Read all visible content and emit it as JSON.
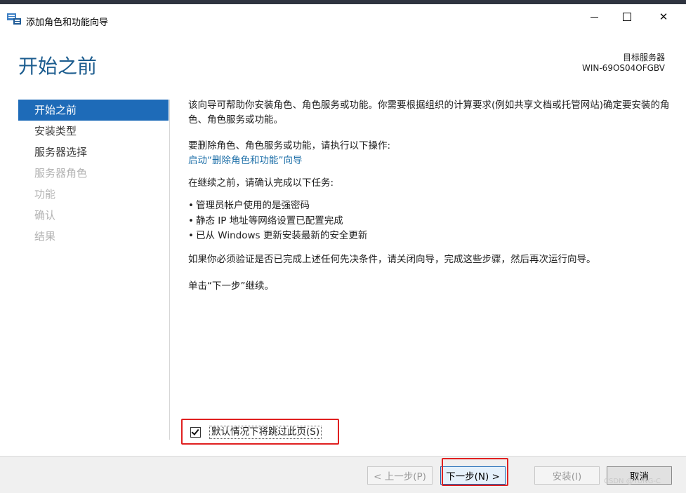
{
  "window": {
    "title": "添加角色和功能向导",
    "minimize_icon": "minimize-icon",
    "maximize_icon": "maximize-icon",
    "close_icon": "close-icon"
  },
  "header": {
    "page_title": "开始之前",
    "destination_label": "目标服务器",
    "destination_server": "WIN-69OS04OFGBV"
  },
  "nav": {
    "items": [
      {
        "label": "开始之前",
        "state": "active"
      },
      {
        "label": "安装类型",
        "state": "enabled"
      },
      {
        "label": "服务器选择",
        "state": "enabled"
      },
      {
        "label": "服务器角色",
        "state": "disabled"
      },
      {
        "label": "功能",
        "state": "disabled"
      },
      {
        "label": "确认",
        "state": "disabled"
      },
      {
        "label": "结果",
        "state": "disabled"
      }
    ]
  },
  "content": {
    "intro": "该向导可帮助你安装角色、角色服务或功能。你需要根据组织的计算要求(例如共享文档或托管网站)确定要安装的角色、角色服务或功能。",
    "remove_text": "要删除角色、角色服务或功能，请执行以下操作:",
    "remove_link": "启动“删除角色和功能”向导",
    "before_text": "在继续之前，请确认完成以下任务:",
    "tasks": [
      "管理员帐户使用的是强密码",
      "静态 IP 地址等网络设置已配置完成",
      "已从 Windows 更新安装最新的安全更新"
    ],
    "verify_text": "如果你必须验证是否已完成上述任何先决条件，请关闭向导，完成这些步骤，然后再次运行向导。",
    "continue_text": "单击“下一步”继续。"
  },
  "skip_checkbox": {
    "label": "默认情况下将跳过此页(S)",
    "checked": true
  },
  "footer": {
    "prev_label": "< 上一步(P)",
    "next_label": "下一步(N) >",
    "install_label": "安装(I)",
    "cancel_label": "取消"
  },
  "watermark": "CSDN @YUNG-C",
  "colors": {
    "accent": "#1e6bb8",
    "heading": "#1d5d8f",
    "link": "#1d6fa8",
    "highlight": "#e02020"
  }
}
